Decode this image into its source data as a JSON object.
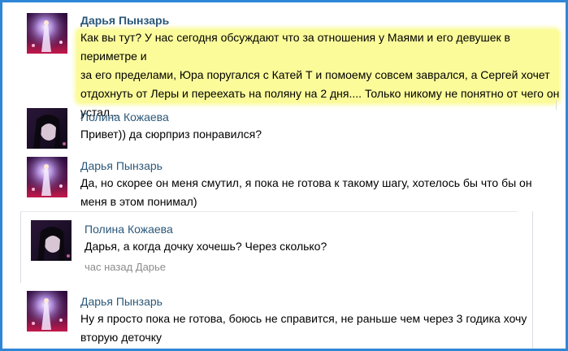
{
  "messages": [
    {
      "author": "Дарья Пынзарь",
      "lines": [
        "Как вы тут? У нас сегодня обсуждают что за отношения у Маями и его девушек в периметре и",
        "за его пределами, Юра поругался с Катей Т и помоему совсем заврался, а Сергей хочет",
        "отдохнуть от Леры и переехать на поляну на 2 дня.... Только никому не понятно от чего он",
        "устал..."
      ]
    },
    {
      "author": "Полина Кожаева",
      "lines": [
        "Привет)) да сюрприз понравился?"
      ]
    },
    {
      "author": "Дарья Пынзарь",
      "lines": [
        "Да, но скорее он меня смутил, я пока не готова к такому шагу, хотелось бы что бы он",
        "меня в этом понимал)"
      ]
    },
    {
      "author": "Полина Кожаева",
      "lines": [
        "Дарья, а когда дочку хочешь? Через сколько?"
      ],
      "time": "час назад Дарье"
    },
    {
      "author": "Дарья Пынзарь",
      "lines": [
        "Ну я просто пока не готова, боюсь не справится, не раньше чем через 3 годика хочу",
        "вторую деточку"
      ]
    }
  ],
  "colors": {
    "frame": "#2f86d6",
    "author": "#2b587a",
    "highlight": "#fbfb9a",
    "time": "#8c8c8c"
  }
}
